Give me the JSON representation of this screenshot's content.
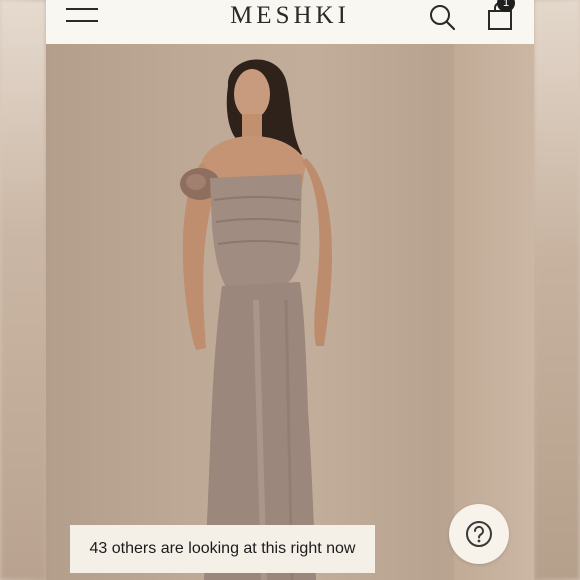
{
  "header": {
    "brand": "MESHKI",
    "cart_count": "1"
  },
  "hero": {
    "viewers_text": "43 others are looking at this right now"
  },
  "icons": {
    "menu": "hamburger-menu-icon",
    "search": "search-icon",
    "bag": "shopping-bag-icon",
    "help": "question-mark-icon"
  },
  "colors": {
    "header_bg": "#f9f7f2",
    "backdrop": "#c3ae9c",
    "dress": "#9d8a7d",
    "banner_bg": "#f4efe7"
  }
}
